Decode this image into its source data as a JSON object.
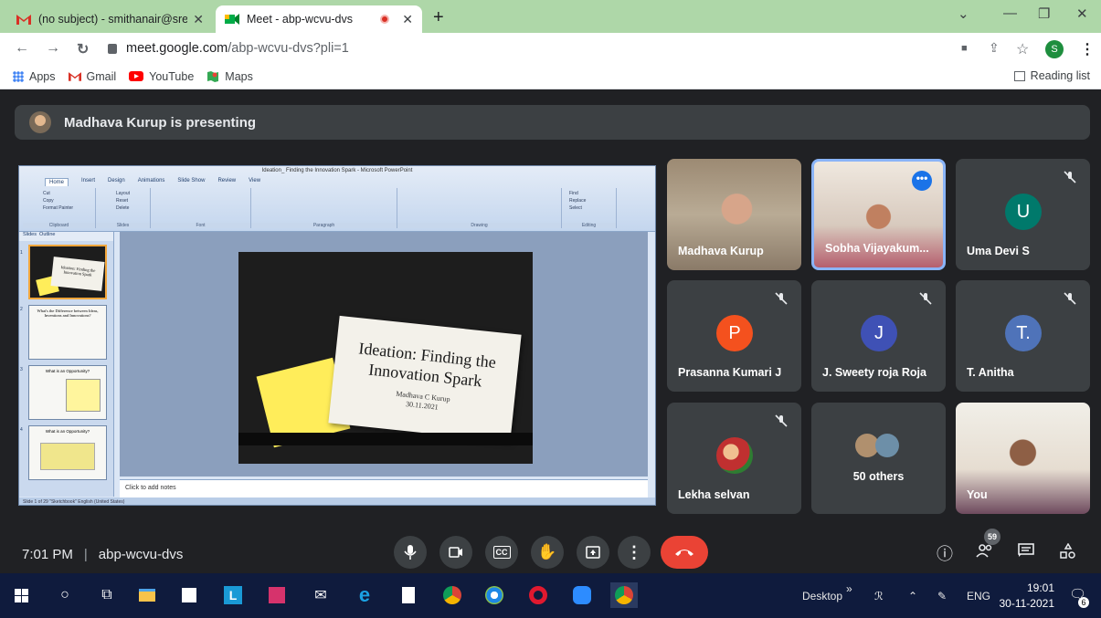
{
  "browser": {
    "tabs": [
      {
        "title": "(no subject) - smithanair@sreeay",
        "icon": "gmail-icon"
      },
      {
        "title": "Meet - abp-wcvu-dvs",
        "icon": "meet-icon"
      }
    ],
    "url_host": "meet.google.com",
    "url_path": "/abp-wcvu-dvs?pli=1",
    "profile_initial": "S",
    "bookmarks": [
      {
        "label": "Apps",
        "icon": "apps-grid-icon"
      },
      {
        "label": "Gmail",
        "icon": "gmail-icon"
      },
      {
        "label": "YouTube",
        "icon": "youtube-icon"
      },
      {
        "label": "Maps",
        "icon": "maps-icon"
      }
    ],
    "reading_list": "Reading list"
  },
  "meet": {
    "presenting_banner": "Madhava Kurup is presenting",
    "presentation": {
      "window_title": "Ideation_ Finding the Innovation Spark - Microsoft PowerPoint",
      "ribbon_tabs": [
        "Home",
        "Insert",
        "Design",
        "Animations",
        "Slide Show",
        "Review",
        "View"
      ],
      "ribbon_groups": [
        "Clipboard",
        "Slides",
        "Font",
        "Paragraph",
        "Drawing",
        "Editing"
      ],
      "clipboard_items": [
        "Cut",
        "Copy",
        "Format Painter"
      ],
      "slides_items": [
        "Layout",
        "Reset",
        "Delete"
      ],
      "editing_items": [
        "Find",
        "Replace",
        "Select"
      ],
      "panel_tabs": [
        "Slides",
        "Outline"
      ],
      "slide_title_line1": "Ideation: Finding the",
      "slide_title_line2": "Innovation Spark",
      "slide_author": "Madhava C Kurup",
      "slide_date": "30.11.2021",
      "thumb1_title": "Ideation: Finding the Innovation Spark",
      "thumb2_title": "What's the Difference between Ideas, Inventions and Innovations?",
      "thumb3_title": "What is an Opportunity?",
      "thumb4_title": "What is an Opportunity?",
      "notes_placeholder": "Click to add notes",
      "status": "Slide 1 of 29   \"Sketchbook\"   English (United States)"
    },
    "participants": [
      {
        "name": "Madhava Kurup",
        "video": true
      },
      {
        "name": "Sobha Vijayakum...",
        "video": true,
        "pinned_menu": "•••"
      },
      {
        "name": "Uma Devi S",
        "initial": "U",
        "color": "#00796b",
        "muted": true
      },
      {
        "name": "Prasanna Kumari J",
        "initial": "P",
        "color": "#f4511e",
        "muted": true
      },
      {
        "name": "J. Sweety roja Roja",
        "initial": "J",
        "color": "#3f51b5",
        "muted": true
      },
      {
        "name": "T. Anitha",
        "initial": "T.",
        "color": "#4f73b9",
        "muted": true
      },
      {
        "name": "Lekha selvan",
        "muted": true
      },
      {
        "name": "50 others"
      },
      {
        "name": "You",
        "video": true
      }
    ],
    "time": "7:01 PM",
    "meeting_code": "abp-wcvu-dvs",
    "people_count": "59",
    "controls": [
      "mic-icon",
      "camera-icon",
      "captions-icon",
      "raise-hand-icon",
      "present-icon",
      "more-options-icon",
      "end-call-icon"
    ],
    "colors": {
      "end_call": "#ea4335",
      "tile_bg": "#3c4043",
      "bg": "#202124",
      "accent": "#1a73e8"
    }
  },
  "taskbar": {
    "desktop": "Desktop",
    "lang": "ENG",
    "time": "19:01",
    "date": "30-11-2021",
    "notif_count": "6"
  }
}
